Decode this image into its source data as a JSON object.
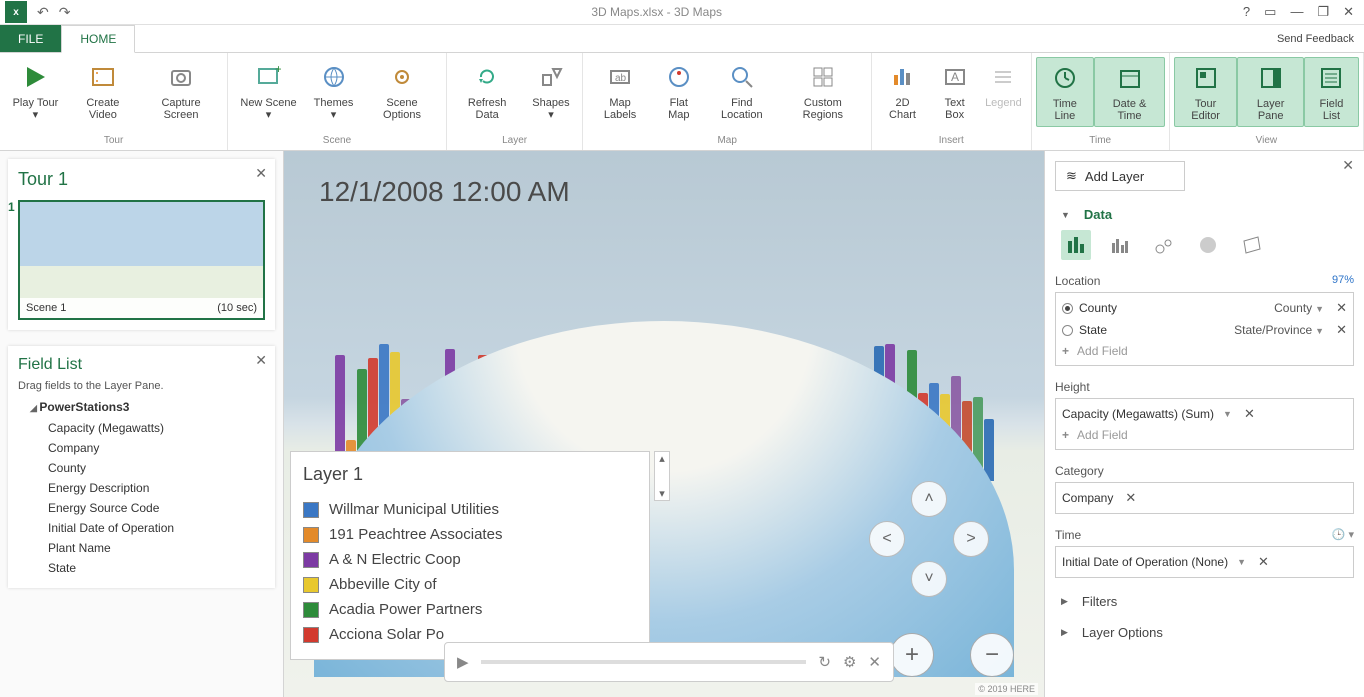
{
  "titlebar": {
    "title": "3D Maps.xlsx - 3D Maps"
  },
  "tabs": {
    "file": "FILE",
    "home": "HOME",
    "feedback": "Send Feedback"
  },
  "ribbon": {
    "groups": [
      {
        "label": "Tour",
        "items": [
          "Play Tour ▾",
          "Create Video",
          "Capture Screen"
        ]
      },
      {
        "label": "Scene",
        "items": [
          "New Scene ▾",
          "Themes ▾",
          "Scene Options"
        ]
      },
      {
        "label": "Layer",
        "items": [
          "Refresh Data",
          "Shapes ▾"
        ]
      },
      {
        "label": "Map",
        "items": [
          "Map Labels",
          "Flat Map",
          "Find Location",
          "Custom Regions"
        ]
      },
      {
        "label": "Insert",
        "items": [
          "2D Chart",
          "Text Box",
          "Legend"
        ]
      },
      {
        "label": "Time",
        "items": [
          "Time Line",
          "Date & Time"
        ]
      },
      {
        "label": "View",
        "items": [
          "Tour Editor",
          "Layer Pane",
          "Field List"
        ]
      }
    ]
  },
  "tour": {
    "title": "Tour 1",
    "scene_num": "1",
    "scene_name": "Scene 1",
    "scene_dur": "(10 sec)"
  },
  "fieldlist": {
    "title": "Field List",
    "subtitle": "Drag fields to the Layer Pane.",
    "table": "PowerStations3",
    "fields": [
      "Capacity (Megawatts)",
      "Company",
      "County",
      "Energy Description",
      "Energy Source Code",
      "Initial Date of Operation",
      "Plant Name",
      "State"
    ]
  },
  "map": {
    "timestamp": "12/1/2008 12:00 AM",
    "legend_title": "Layer 1",
    "legend": [
      {
        "color": "#3a77c4",
        "label": "Willmar Municipal Utilities"
      },
      {
        "color": "#e38a2a",
        "label": "191 Peachtree Associates"
      },
      {
        "color": "#7c3aa3",
        "label": "A & N Electric Coop"
      },
      {
        "color": "#e8c82e",
        "label": "Abbeville City of"
      },
      {
        "color": "#2e8b3a",
        "label": "Acadia Power Partners"
      },
      {
        "color": "#d23a2e",
        "label": "Acciona Solar Po"
      }
    ],
    "attribution": "© 2019 HERE"
  },
  "layer": {
    "add": "Add Layer",
    "sec_data": "Data",
    "loc_label": "Location",
    "loc_pct": "97%",
    "loc_rows": [
      {
        "on": true,
        "name": "County",
        "geo": "County"
      },
      {
        "on": false,
        "name": "State",
        "geo": "State/Province"
      }
    ],
    "addfield": "Add Field",
    "height_label": "Height",
    "height_value": "Capacity (Megawatts) (Sum)",
    "cat_label": "Category",
    "cat_value": "Company",
    "time_label": "Time",
    "time_value": "Initial Date of Operation (None)",
    "filters": "Filters",
    "options": "Layer Options"
  }
}
